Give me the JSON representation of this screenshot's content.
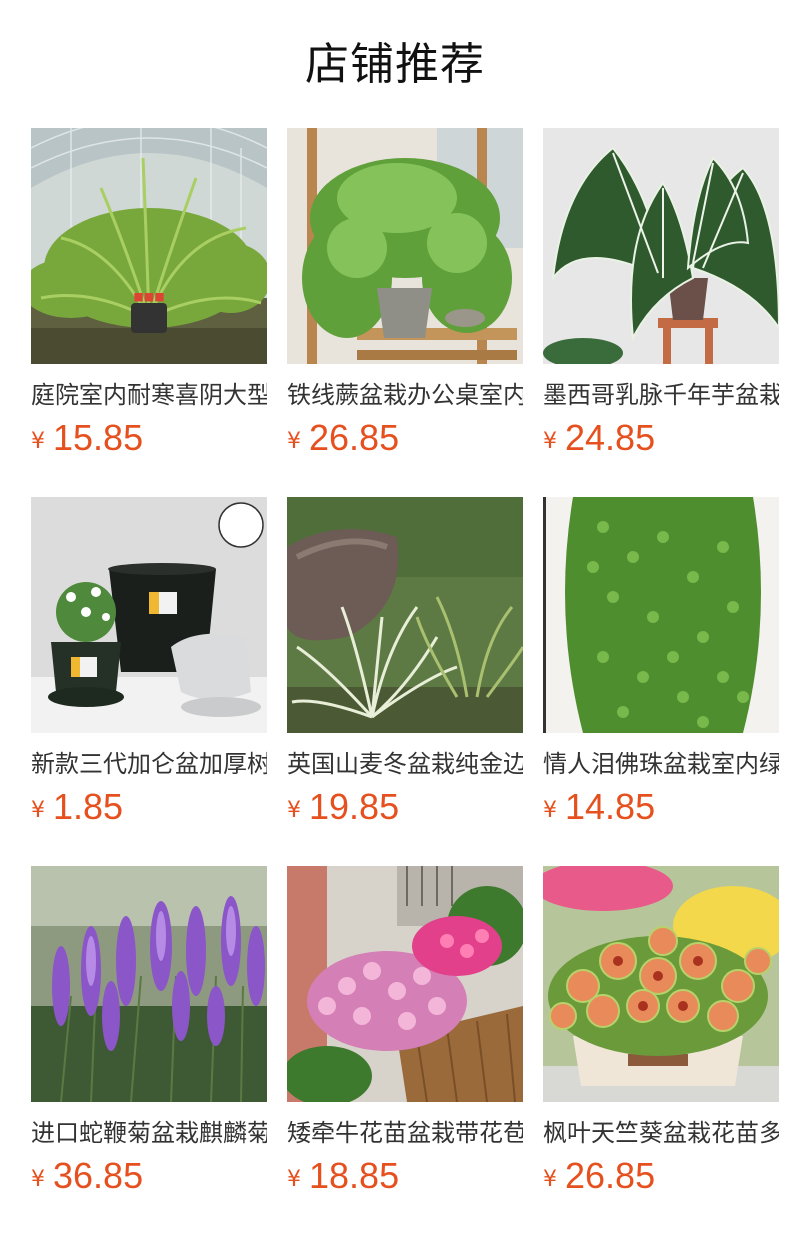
{
  "title": "店铺推荐",
  "currency": "¥",
  "accent_color": "#e6501e",
  "products": [
    {
      "name": "庭院室内耐寒喜阴大型",
      "price": "15.85",
      "image": "fern-greenhouse"
    },
    {
      "name": "铁线蕨盆栽办公桌室内",
      "price": "26.85",
      "image": "maidenhair-fern"
    },
    {
      "name": "墨西哥乳脉千年芋盆栽",
      "price": "24.85",
      "image": "alocasia-zebra"
    },
    {
      "name": "新款三代加仑盆加厚树",
      "price": "1.85",
      "image": "black-gallon-pots"
    },
    {
      "name": "英国山麦冬盆栽纯金边",
      "price": "19.85",
      "image": "variegated-liriope"
    },
    {
      "name": "情人泪佛珠盆栽室内绿",
      "price": "14.85",
      "image": "string-of-pearls"
    },
    {
      "name": "进口蛇鞭菊盆栽麒麟菊",
      "price": "36.85",
      "image": "purple-liatris"
    },
    {
      "name": "矮牵牛花苗盆栽带花苞",
      "price": "18.85",
      "image": "petunia-planter"
    },
    {
      "name": "枫叶天竺葵盆栽花苗多",
      "price": "26.85",
      "image": "maple-geranium"
    }
  ]
}
